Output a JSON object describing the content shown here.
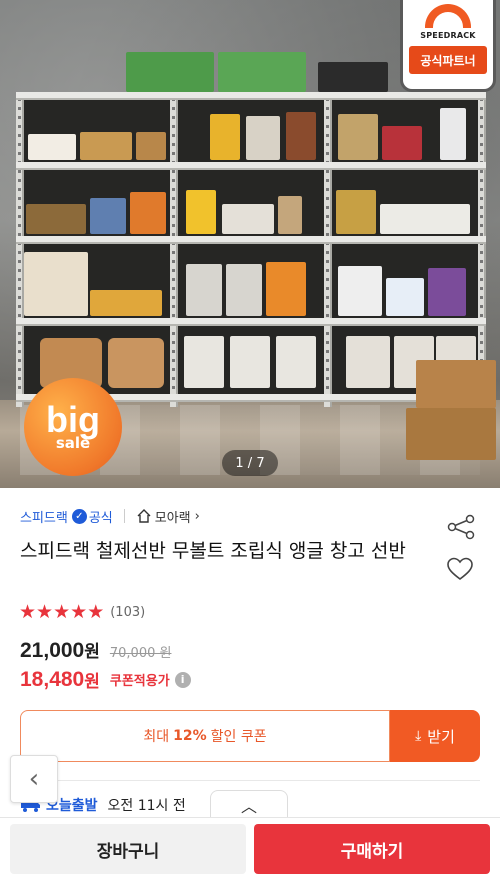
{
  "hero": {
    "image_counter": "1 / 7",
    "brand_badge": {
      "name": "SPEEDRACK",
      "partner_label": "공식파트너"
    },
    "sale_badge": {
      "big": "big",
      "sale": "sale"
    }
  },
  "store": {
    "name": "스피드랙",
    "official_label": "공식",
    "link_label": "모아랙"
  },
  "product": {
    "title": "스피드랙 철제선반 무볼트 조립식 앵글 창고 선반",
    "rating": 5,
    "review_count": "(103)",
    "price": "21,000",
    "price_unit": "원",
    "original_price": "70,000 원",
    "coupon_price": "18,480",
    "coupon_price_unit": "원",
    "coupon_note": "쿠폰적용가",
    "info_icon": "i"
  },
  "coupon": {
    "prefix": "최대",
    "percent": "12%",
    "suffix": "할인 쿠폰",
    "receive_label": "받기"
  },
  "shipping": {
    "label": "오늘출발",
    "time": "오전 11시 전"
  },
  "actions": {
    "cart": "장바구니",
    "buy": "구매하기"
  },
  "colors": {
    "accent_red": "#e8343c",
    "coupon_orange": "#f15a24",
    "link_blue": "#1f5bd8"
  },
  "icons": [
    "share-icon",
    "heart-icon",
    "home-icon",
    "verified-icon",
    "download-icon",
    "truck-icon",
    "chevron-left-icon",
    "chevron-up-icon",
    "info-icon"
  ]
}
